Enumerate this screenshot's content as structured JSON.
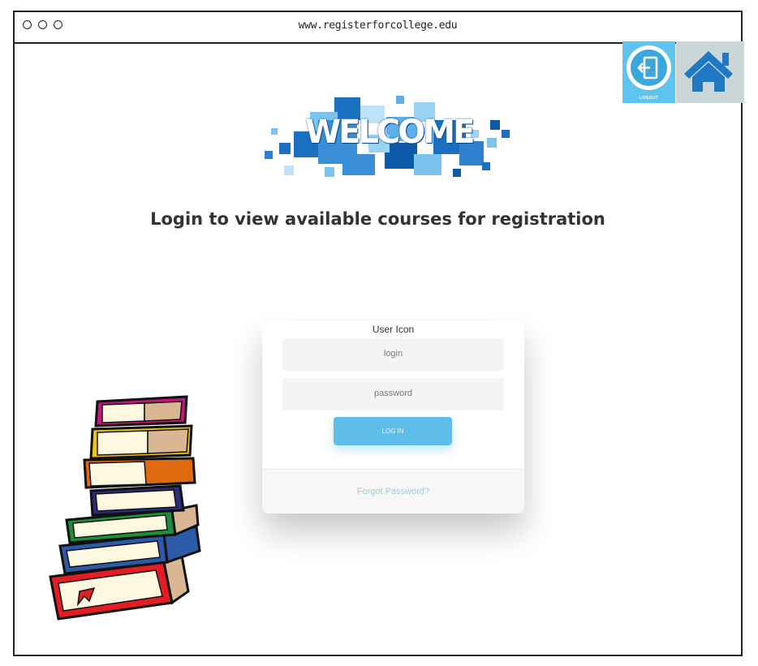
{
  "browser": {
    "url": "www.registerforcollege.edu"
  },
  "header": {
    "logout_label": "LOGOUT"
  },
  "banner": {
    "text": "WELCOME"
  },
  "main": {
    "heading": "Login to view available courses for registration"
  },
  "login_form": {
    "user_icon_label": "User Icon",
    "login_placeholder": "login",
    "password_placeholder": "password",
    "submit_label": "LOG IN",
    "forgot_label": "Forgot Password?"
  },
  "colors": {
    "accent": "#5ebee9",
    "home_icon": "#1f78c1"
  }
}
